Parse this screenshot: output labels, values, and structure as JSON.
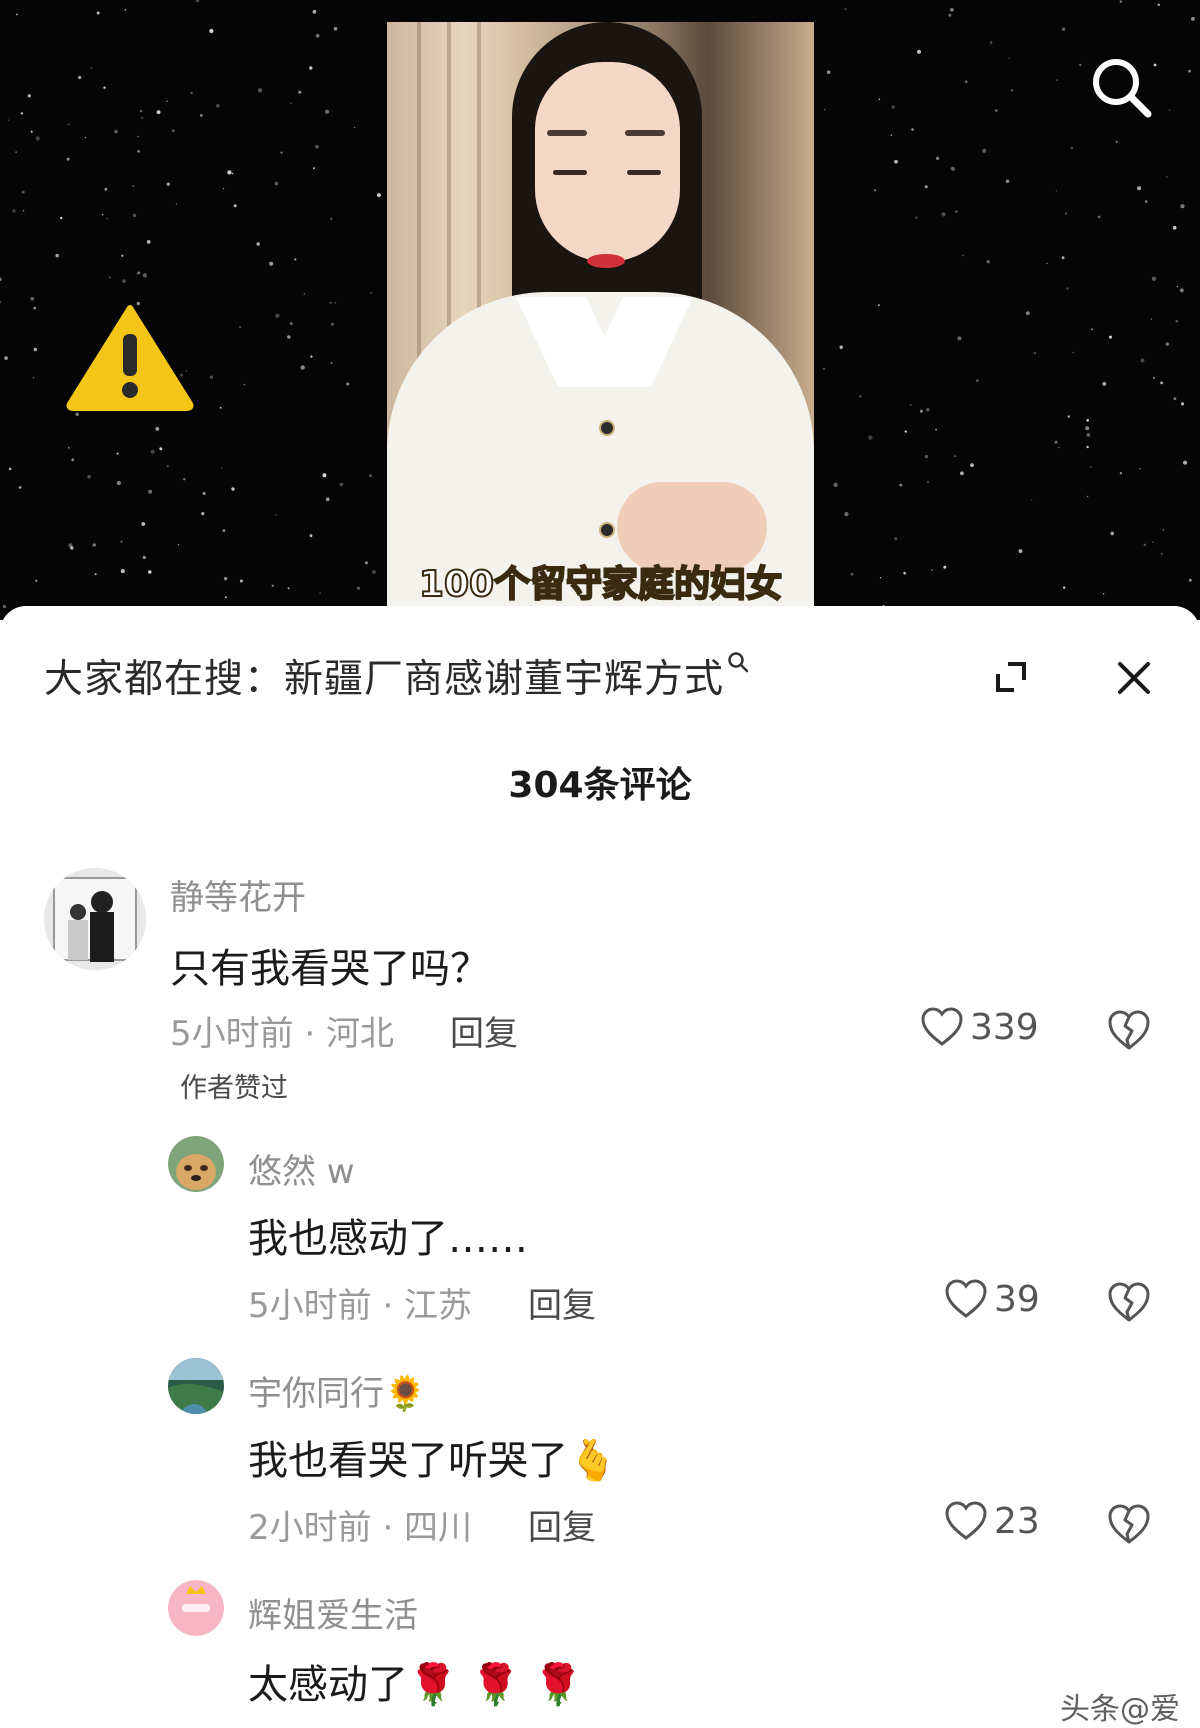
{
  "video": {
    "subtitle_prefix": "100个留守家庭",
    "subtitle_highlight": "的",
    "subtitle_suffix": "妇女"
  },
  "icons": {
    "warning": "warning-triangle-icon",
    "search": "search-icon",
    "expand": "expand-icon",
    "close": "close-icon",
    "like": "heart-icon",
    "dislike": "broken-heart-icon"
  },
  "colors": {
    "warning_yellow": "#f5c518",
    "like_gray": "#555555"
  },
  "search_bar": {
    "prefix": "大家都在搜：",
    "query": "新疆厂商感谢董宇辉方式"
  },
  "comments_header": {
    "title": "304条评论"
  },
  "comments": [
    {
      "username": "静等花开",
      "text": "只有我看哭了吗？",
      "meta": "5小时前 · 河北",
      "reply_label": "回复",
      "likes": "339",
      "author_liked": "作者赞过"
    },
    {
      "username": "悠然 w",
      "text": "我也感动了……",
      "meta": "5小时前 · 江苏",
      "reply_label": "回复",
      "likes": "39"
    },
    {
      "username": "宇你同行🌻",
      "text": "我也看哭了听哭了🫰",
      "meta": "2小时前 · 四川",
      "reply_label": "回复",
      "likes": "23"
    },
    {
      "username": "辉姐爱生活",
      "text": "太感动了🌹 🌹 🌹"
    }
  ],
  "watermark": "头条@爱"
}
